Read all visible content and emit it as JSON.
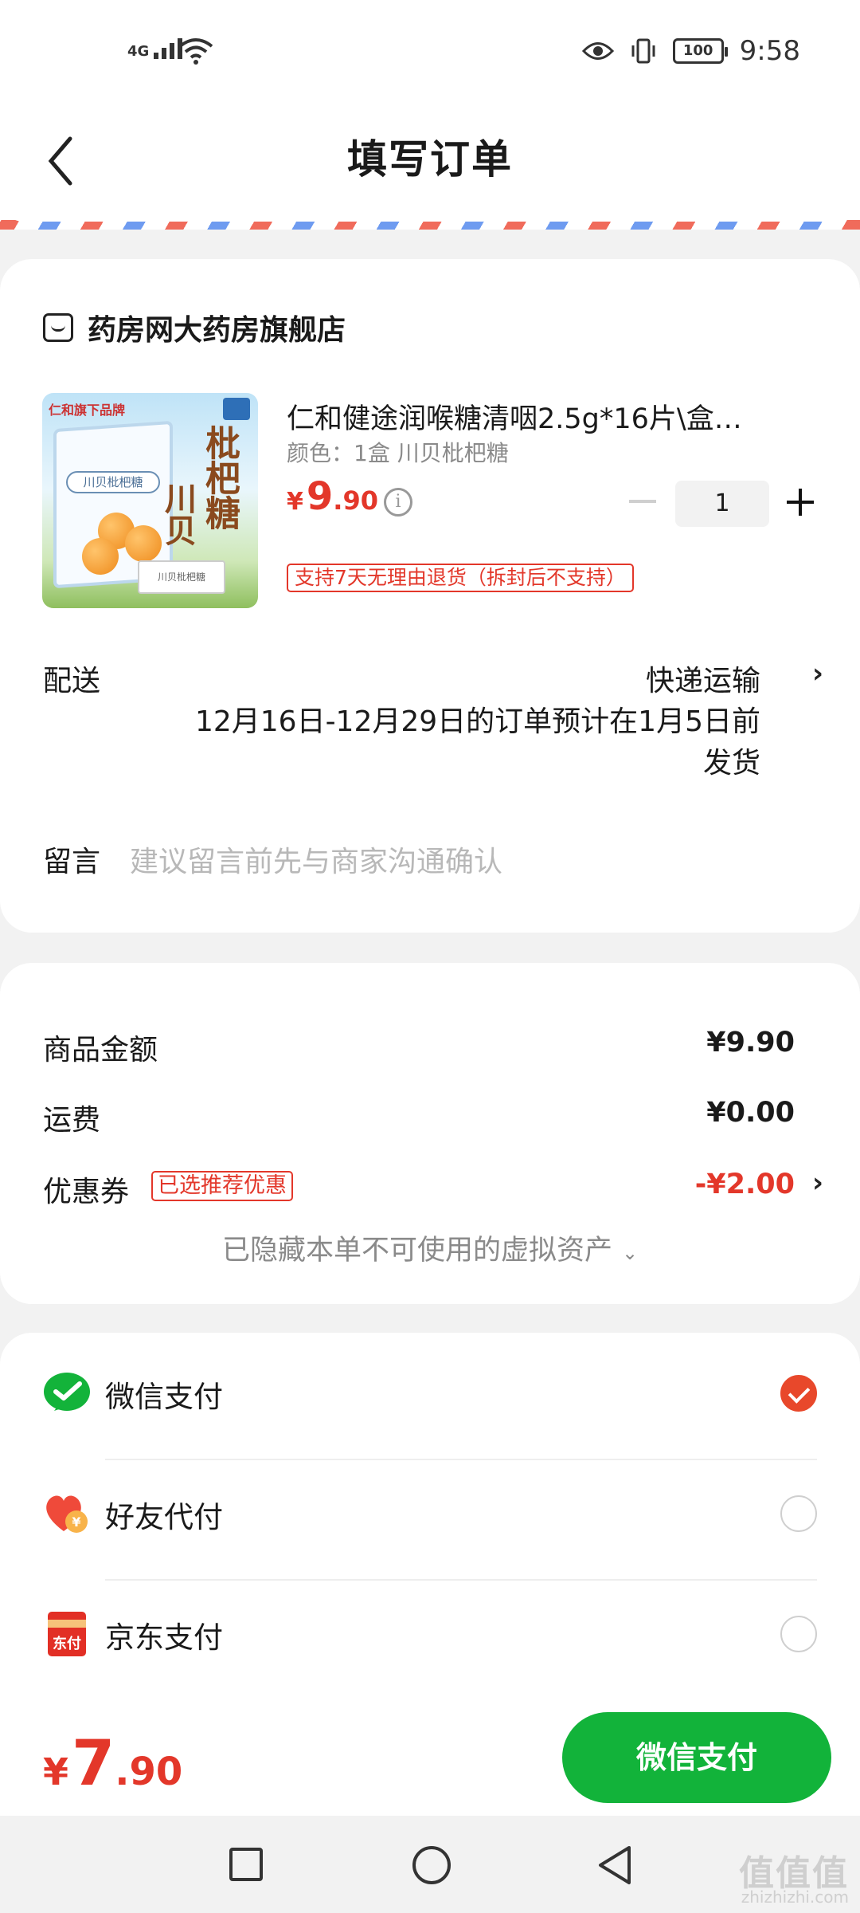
{
  "status_bar": {
    "network": "4G",
    "battery": "100",
    "time": "9:58"
  },
  "header": {
    "title": "填写订单"
  },
  "store": {
    "name": "药房网大药房旗舰店"
  },
  "product": {
    "image_brand": "仁和旗下品牌",
    "image_label": "川贝枇杷糖",
    "image_text_big": "枇杷糖",
    "image_text_big2": "川贝",
    "title": "仁和健途润喉糖清咽2.5g*16片\\盒…",
    "spec": "颜色：1盒 川贝枇杷糖",
    "price_currency": "¥",
    "price_int": "9",
    "price_dec": ".90",
    "quantity": "1",
    "return_policy": "支持7天无理由退货（拆封后不支持）"
  },
  "delivery": {
    "label": "配送",
    "method": "快递运输",
    "note": "12月16日-12月29日的订单预计在1月5日前发货"
  },
  "message": {
    "label": "留言",
    "placeholder": "建议留言前先与商家沟通确认"
  },
  "summary": {
    "goods_label": "商品金额",
    "goods_value": "¥9.90",
    "shipping_label": "运费",
    "shipping_value": "¥0.00",
    "coupon_label": "优惠券",
    "coupon_tag": "已选推荐优惠",
    "coupon_value": "-¥2.00",
    "hidden_note": "已隐藏本单不可使用的虚拟资产"
  },
  "payment_methods": [
    {
      "label": "微信支付",
      "icon": "wechat-pay-icon",
      "selected": true
    },
    {
      "label": "好友代付",
      "icon": "friend-pay-icon",
      "selected": false
    },
    {
      "label": "京东支付",
      "icon": "jd-pay-icon",
      "selected": false
    }
  ],
  "bottom": {
    "currency": "¥",
    "total_int": "7",
    "total_dec": ".90",
    "pay_button": "微信支付"
  },
  "watermark": {
    "text": "值值值",
    "url": "zhizhizhi.com"
  },
  "colors": {
    "accent_red": "#e3372a",
    "pay_green": "#12b33a"
  }
}
